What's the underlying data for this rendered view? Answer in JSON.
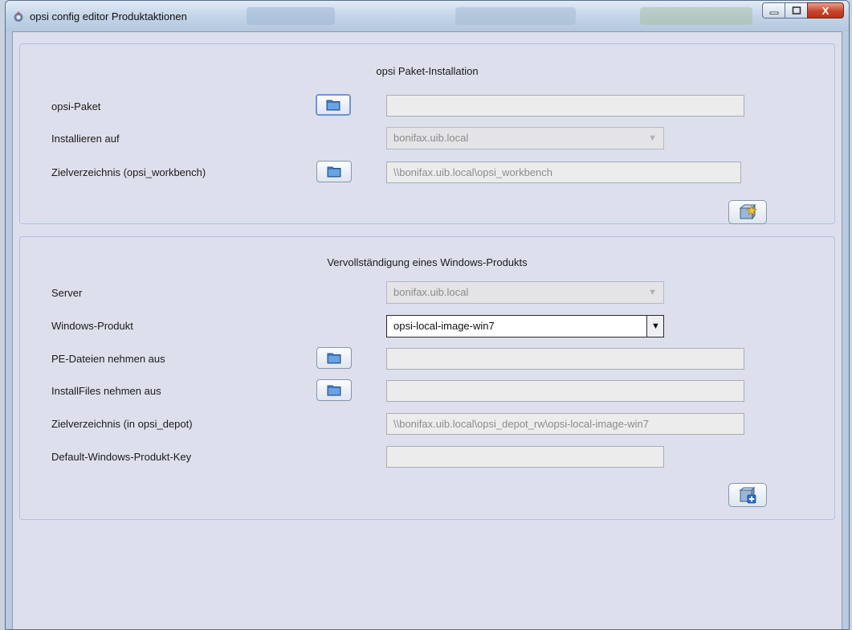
{
  "window": {
    "title": "opsi config editor Produktaktionen",
    "close_glyph": "X"
  },
  "install": {
    "heading": "opsi Paket-Installation",
    "package_label": "opsi-Paket",
    "package_value": "",
    "install_on_label": "Installieren auf",
    "install_on_value": "bonifax.uib.local",
    "target_dir_label": "Zielverzeichnis (opsi_workbench)",
    "target_dir_value": "\\\\bonifax.uib.local\\opsi_workbench",
    "action_icon": "package-install-icon"
  },
  "complete": {
    "heading": "Vervollständigung eines Windows-Produkts",
    "server_label": "Server",
    "server_value": "bonifax.uib.local",
    "product_label": "Windows-Produkt",
    "product_value": "opsi-local-image-win7",
    "pe_label": "PE-Dateien nehmen aus",
    "pe_value": "",
    "installfiles_label": "InstallFiles nehmen aus",
    "installfiles_value": "",
    "target_dir_label": "Zielverzeichnis (in opsi_depot)",
    "target_dir_value": "\\\\bonifax.uib.local\\opsi_depot_rw\\opsi-local-image-win7",
    "key_label": "Default-Windows-Produkt-Key",
    "key_value": "",
    "action_icon": "product-complete-icon"
  }
}
